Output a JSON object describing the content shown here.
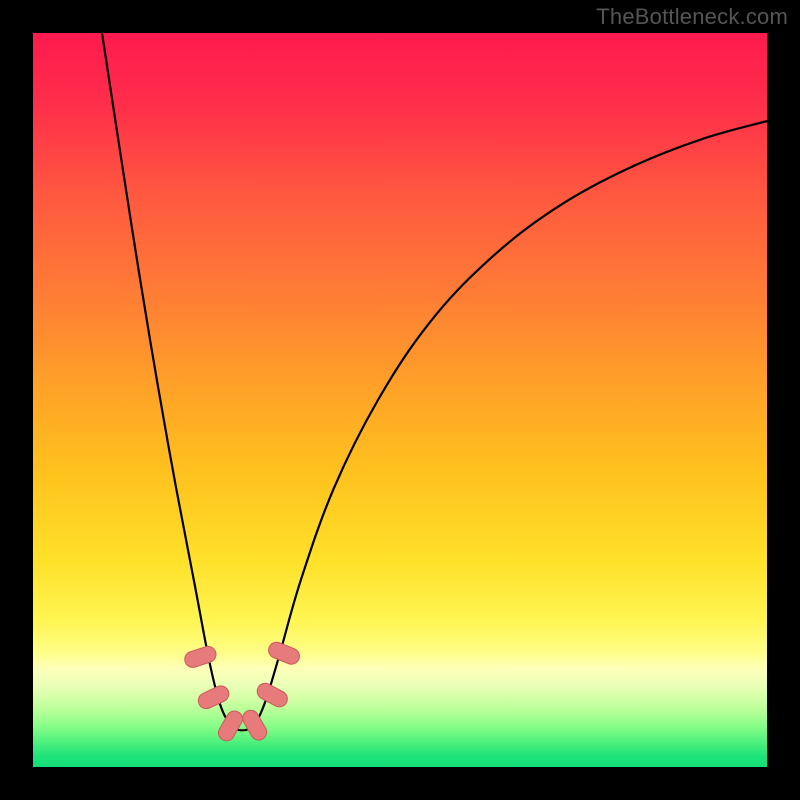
{
  "watermark": "TheBottleneck.com",
  "colors": {
    "frame": "#000000",
    "curve": "#000000",
    "marker_fill": "#e77a7a",
    "marker_stroke": "#c95b5b",
    "gradient_stops": [
      {
        "offset": 0.0,
        "color": "#ff1a4f"
      },
      {
        "offset": 0.1,
        "color": "#ff2f4a"
      },
      {
        "offset": 0.22,
        "color": "#ff5840"
      },
      {
        "offset": 0.35,
        "color": "#ff7b36"
      },
      {
        "offset": 0.48,
        "color": "#ffa128"
      },
      {
        "offset": 0.6,
        "color": "#ffc21e"
      },
      {
        "offset": 0.72,
        "color": "#ffe12a"
      },
      {
        "offset": 0.8,
        "color": "#fff552"
      },
      {
        "offset": 0.845,
        "color": "#ffff8a"
      },
      {
        "offset": 0.865,
        "color": "#fdffb8"
      },
      {
        "offset": 0.885,
        "color": "#eeffb8"
      },
      {
        "offset": 0.905,
        "color": "#d6ffa8"
      },
      {
        "offset": 0.925,
        "color": "#b3ff96"
      },
      {
        "offset": 0.945,
        "color": "#86fd88"
      },
      {
        "offset": 0.965,
        "color": "#51f17e"
      },
      {
        "offset": 0.985,
        "color": "#1fe37a"
      },
      {
        "offset": 1.0,
        "color": "#13dd78"
      }
    ]
  },
  "chart_data": {
    "type": "line",
    "title": "",
    "xlabel": "",
    "ylabel": "",
    "xlim": [
      0,
      100
    ],
    "ylim": [
      0,
      100
    ],
    "note": "x/y are in percent of the inner plot area (0,0 at top-left). Curve depicts a bottleneck profile with minimum near x≈28%.",
    "series": [
      {
        "name": "bottleneck-curve",
        "points": [
          {
            "x": 9.4,
            "y": 0.0
          },
          {
            "x": 12.0,
            "y": 17.0
          },
          {
            "x": 14.5,
            "y": 33.0
          },
          {
            "x": 17.0,
            "y": 48.0
          },
          {
            "x": 19.5,
            "y": 62.0
          },
          {
            "x": 22.0,
            "y": 75.0
          },
          {
            "x": 24.0,
            "y": 85.5
          },
          {
            "x": 25.5,
            "y": 91.5
          },
          {
            "x": 27.0,
            "y": 94.3
          },
          {
            "x": 28.5,
            "y": 95.0
          },
          {
            "x": 30.0,
            "y": 94.3
          },
          {
            "x": 31.5,
            "y": 91.5
          },
          {
            "x": 33.5,
            "y": 85.0
          },
          {
            "x": 36.5,
            "y": 74.5
          },
          {
            "x": 41.0,
            "y": 62.0
          },
          {
            "x": 47.0,
            "y": 50.0
          },
          {
            "x": 54.0,
            "y": 39.5
          },
          {
            "x": 62.0,
            "y": 31.0
          },
          {
            "x": 71.0,
            "y": 24.0
          },
          {
            "x": 81.0,
            "y": 18.5
          },
          {
            "x": 91.0,
            "y": 14.5
          },
          {
            "x": 100.0,
            "y": 12.0
          }
        ]
      }
    ],
    "markers": [
      {
        "x": 22.8,
        "y": 85.0,
        "angle": 72
      },
      {
        "x": 24.6,
        "y": 90.5,
        "angle": 65
      },
      {
        "x": 26.9,
        "y": 94.4,
        "angle": 30
      },
      {
        "x": 30.2,
        "y": 94.3,
        "angle": -30
      },
      {
        "x": 32.6,
        "y": 90.2,
        "angle": -62
      },
      {
        "x": 34.2,
        "y": 84.5,
        "angle": -68
      }
    ]
  }
}
